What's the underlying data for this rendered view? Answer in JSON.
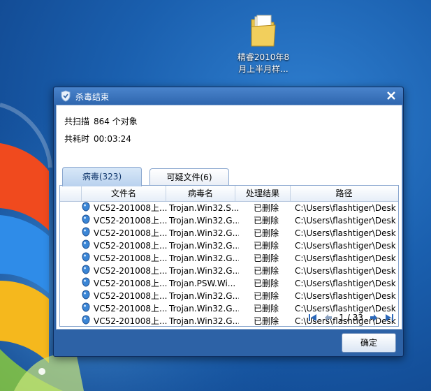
{
  "desktop": {
    "folder_label_line1": "精睿2010年8",
    "folder_label_line2": "月上半月样..."
  },
  "dialog": {
    "title": "杀毒结束",
    "scan_label": "共扫描",
    "scan_value": "864 个对象",
    "time_label": "共耗时",
    "time_value": "00:03:24",
    "tabs": [
      {
        "label": "病毒(323)",
        "active": true
      },
      {
        "label": "可疑文件(6)",
        "active": false
      }
    ],
    "columns": [
      "文件名",
      "病毒名",
      "处理结果",
      "路径"
    ],
    "rows": [
      {
        "file": "VC52-201008上...",
        "virus": "Trojan.Win32.S...",
        "result": "已删除",
        "path": "C:\\Users\\flashtiger\\Desk..."
      },
      {
        "file": "VC52-201008上...",
        "virus": "Trojan.Win32.G...",
        "result": "已删除",
        "path": "C:\\Users\\flashtiger\\Desk..."
      },
      {
        "file": "VC52-201008上...",
        "virus": "Trojan.Win32.G...",
        "result": "已删除",
        "path": "C:\\Users\\flashtiger\\Desk..."
      },
      {
        "file": "VC52-201008上...",
        "virus": "Trojan.Win32.G...",
        "result": "已删除",
        "path": "C:\\Users\\flashtiger\\Desk..."
      },
      {
        "file": "VC52-201008上...",
        "virus": "Trojan.Win32.G...",
        "result": "已删除",
        "path": "C:\\Users\\flashtiger\\Desk..."
      },
      {
        "file": "VC52-201008上...",
        "virus": "Trojan.Win32.G...",
        "result": "已删除",
        "path": "C:\\Users\\flashtiger\\Desk..."
      },
      {
        "file": "VC52-201008上...",
        "virus": "Trojan.PSW.Wi...",
        "result": "已删除",
        "path": "C:\\Users\\flashtiger\\Desk..."
      },
      {
        "file": "VC52-201008上...",
        "virus": "Trojan.Win32.G...",
        "result": "已删除",
        "path": "C:\\Users\\flashtiger\\Desk..."
      },
      {
        "file": "VC52-201008上...",
        "virus": "Trojan.Win32.G...",
        "result": "已删除",
        "path": "C:\\Users\\flashtiger\\Desk..."
      },
      {
        "file": "VC52-201008上...",
        "virus": "Trojan.Win32.G...",
        "result": "已删除",
        "path": "C:\\Users\\flashtiger\\Desk..."
      }
    ],
    "pager_text": "1 / 33",
    "ok_label": "确定",
    "icons": {
      "title": "shield-icon",
      "close": "close-icon",
      "row": "virus-file-icon",
      "first": "first-page-icon",
      "prev": "prev-page-icon",
      "next": "next-page-icon",
      "last": "last-page-icon"
    }
  }
}
